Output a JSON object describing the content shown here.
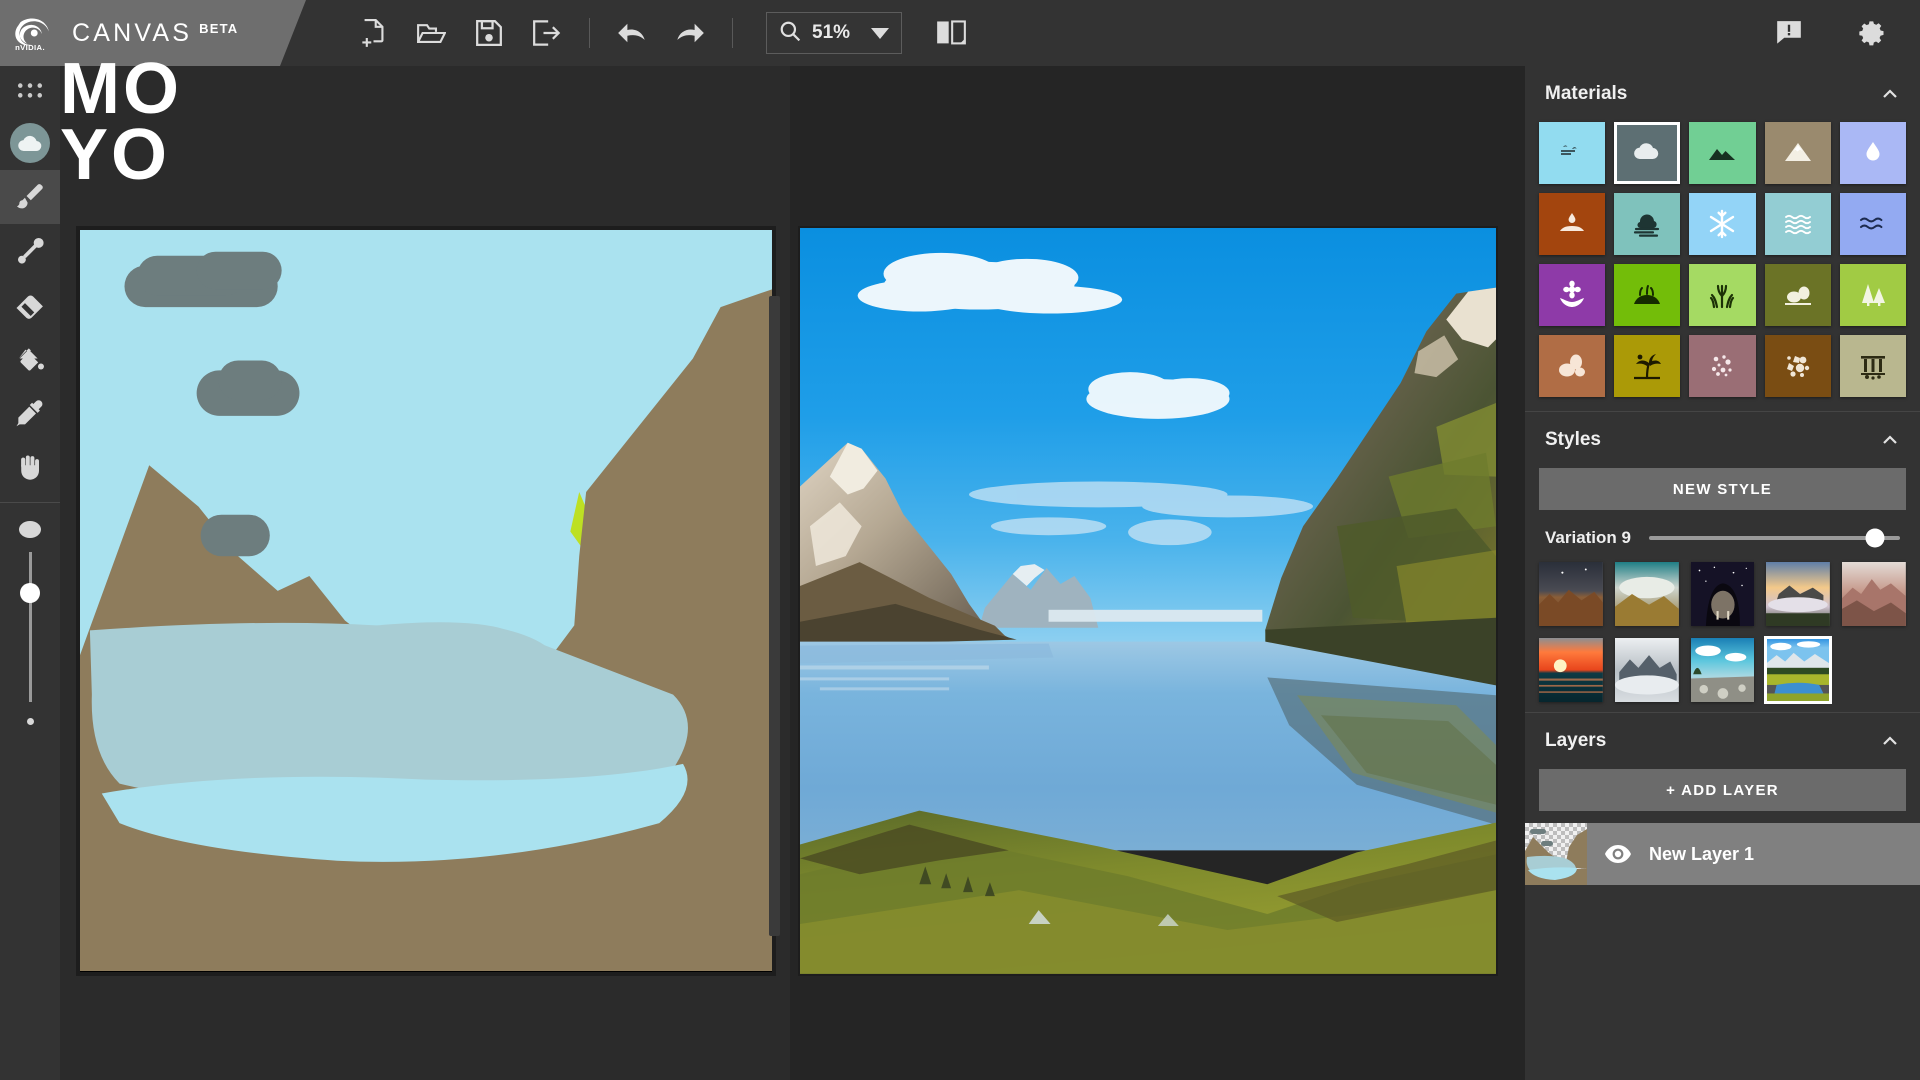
{
  "app": {
    "brand": "CANVAS",
    "beta": "BETA",
    "logo_icon": "nvidia-logo-icon"
  },
  "toolbar": {
    "items": [
      {
        "name": "new-file-button",
        "icon": "new-file-icon",
        "label": "New"
      },
      {
        "name": "open-file-button",
        "icon": "folder-open-icon",
        "label": "Open"
      },
      {
        "name": "save-button",
        "icon": "save-disk-icon",
        "label": "Save"
      },
      {
        "name": "export-button",
        "icon": "export-icon",
        "label": "Export"
      },
      {
        "name": "undo-button",
        "icon": "undo-arrow-icon",
        "label": "Undo"
      },
      {
        "name": "redo-button",
        "icon": "redo-arrow-icon",
        "label": "Redo"
      }
    ],
    "zoom": {
      "icon": "magnifier-icon",
      "value": "51%",
      "dropdown_icon": "caret-down-icon"
    },
    "compare_icon": "compare-panels-icon",
    "feedback_icon": "feedback-bubble-icon",
    "settings_icon": "gear-icon"
  },
  "left_rail": {
    "apps_icon": "grid-dots-icon",
    "current_material_icon": "cloud-icon",
    "tools": [
      {
        "name": "tool-paintbrush",
        "icon": "paintbrush-icon",
        "label": "Paint Brush",
        "selected": true
      },
      {
        "name": "tool-line",
        "icon": "line-tool-icon",
        "label": "Line",
        "selected": false
      },
      {
        "name": "tool-eraser",
        "icon": "eraser-icon",
        "label": "Eraser",
        "selected": false
      },
      {
        "name": "tool-fill",
        "icon": "paint-bucket-icon",
        "label": "Fill",
        "selected": false
      },
      {
        "name": "tool-eyedropper",
        "icon": "eyedropper-icon",
        "label": "Eyedropper",
        "selected": false
      },
      {
        "name": "tool-pan",
        "icon": "hand-icon",
        "label": "Pan",
        "selected": false
      }
    ],
    "brush_size": {
      "max_icon": "large-brush-dot-icon",
      "min_icon": "small-brush-dot-icon",
      "handle_position_pct": 27
    }
  },
  "watermark": {
    "line1": "MO",
    "line2": "YO"
  },
  "canvas": {
    "sketch_label": "segmentation-sketch",
    "render_label": "ai-rendered-output",
    "scrollbar": "vertical-scrollbar"
  },
  "panel": {
    "materials": {
      "title": "Materials",
      "collapse_icon": "chevron-up-icon",
      "swatches": [
        {
          "name": "material-sky",
          "label": "Sky",
          "color": "#92dcf0",
          "icon": "birds-sky-icon",
          "fg": "#1f2b2e",
          "selected": false
        },
        {
          "name": "material-clouds",
          "label": "Clouds",
          "color": "#5d6f73",
          "icon": "cloud-icon",
          "fg": "#e8edee",
          "selected": true
        },
        {
          "name": "material-hill",
          "label": "Hill",
          "color": "#71cf94",
          "icon": "hill-icon",
          "fg": "#173021",
          "selected": false
        },
        {
          "name": "material-mountain",
          "label": "Mountain",
          "color": "#9a8a6e",
          "icon": "mountain-icon",
          "fg": "#f3efe4",
          "selected": false
        },
        {
          "name": "material-water",
          "label": "Water",
          "color": "#aab8f5",
          "icon": "waterdrop-icon",
          "fg": "#ffffff",
          "selected": false
        },
        {
          "name": "material-mud",
          "label": "Mud",
          "color": "#a3450e",
          "icon": "mud-splash-icon",
          "fg": "#f7e9dd",
          "selected": false
        },
        {
          "name": "material-fog",
          "label": "Fog",
          "color": "#7fc2bc",
          "icon": "fog-icon",
          "fg": "#1e3533",
          "selected": false
        },
        {
          "name": "material-snow",
          "label": "Snow",
          "color": "#93d4f7",
          "icon": "snowflake-icon",
          "fg": "#ffffff",
          "selected": false
        },
        {
          "name": "material-sea",
          "label": "Sea",
          "color": "#93cdd3",
          "icon": "waves-white-icon",
          "fg": "#ffffff",
          "selected": false
        },
        {
          "name": "material-river",
          "label": "River",
          "color": "#93aaf2",
          "icon": "waves-dark-icon",
          "fg": "#1d2b4f",
          "selected": false
        },
        {
          "name": "material-flowers",
          "label": "Flowers",
          "color": "#8e3aa8",
          "icon": "flower-icon",
          "fg": "#ffffff",
          "selected": false
        },
        {
          "name": "material-grass",
          "label": "Grass",
          "color": "#73bd09",
          "icon": "grass-tuft-icon",
          "fg": "#152b00",
          "selected": false
        },
        {
          "name": "material-straw",
          "label": "Straw",
          "color": "#a5da63",
          "icon": "reeds-icon",
          "fg": "#1c3106",
          "selected": false
        },
        {
          "name": "material-bush",
          "label": "Bush",
          "color": "#6b7326",
          "icon": "bush-icon",
          "fg": "#f2f0df",
          "selected": false
        },
        {
          "name": "material-tree",
          "label": "Tree",
          "color": "#a1cb44",
          "icon": "pine-trees-icon",
          "fg": "#f2f5e4",
          "selected": false
        },
        {
          "name": "material-rock",
          "label": "Rock",
          "color": "#b06d45",
          "icon": "rocks-icon",
          "fg": "#f7e5d6",
          "selected": false
        },
        {
          "name": "material-sand",
          "label": "Sand",
          "color": "#ab9a07",
          "icon": "palm-beach-icon",
          "fg": "#1d1a00",
          "selected": false
        },
        {
          "name": "material-snow-dust",
          "label": "Snow Dust",
          "color": "#9a6e75",
          "icon": "snow-dust-icon",
          "fg": "#f6e8ea",
          "selected": false
        },
        {
          "name": "material-dirt",
          "label": "Dirt",
          "color": "#7a4d13",
          "icon": "dirt-clump-icon",
          "fg": "#f0e6d6",
          "selected": false
        },
        {
          "name": "material-ruins",
          "label": "Ruins",
          "color": "#b9b78f",
          "icon": "ruins-icon",
          "fg": "#2d2b14",
          "selected": false
        }
      ]
    },
    "styles": {
      "title": "Styles",
      "collapse_icon": "chevron-up-icon",
      "new_style_label": "NEW STYLE",
      "variation_label": "Variation 9",
      "variation_value": 9,
      "variation_max": 10,
      "thumbnails": [
        {
          "name": "style-thumb-1",
          "desc": "desert-buttes-night",
          "selected": false
        },
        {
          "name": "style-thumb-2",
          "desc": "cloudy-cliffs",
          "selected": false
        },
        {
          "name": "style-thumb-3",
          "desc": "starry-cave-arch",
          "selected": false
        },
        {
          "name": "style-thumb-4",
          "desc": "sunset-fog-valley",
          "selected": false
        },
        {
          "name": "style-thumb-5",
          "desc": "pink-rocky-ridge",
          "selected": false
        },
        {
          "name": "style-thumb-6",
          "desc": "orange-ocean-sunset",
          "selected": false
        },
        {
          "name": "style-thumb-7",
          "desc": "grey-misty-peaks",
          "selected": false
        },
        {
          "name": "style-thumb-8",
          "desc": "turquoise-shoreline",
          "selected": false
        },
        {
          "name": "style-thumb-9",
          "desc": "alpine-lake-meadow",
          "selected": true
        }
      ]
    },
    "layers": {
      "title": "Layers",
      "collapse_icon": "chevron-up-icon",
      "add_layer_label": "+ ADD LAYER",
      "items": [
        {
          "name": "layer-row-new-layer-1",
          "label": "New Layer 1",
          "visibility_icon": "eye-icon",
          "visible": true,
          "selected": true
        }
      ]
    }
  },
  "colors": {
    "topbar_bg": "#333333",
    "brand_bg": "#6e6e6e",
    "workspace_bg": "#2b2b2b",
    "panel_bg": "#333333",
    "button_grey": "#6b6b6b",
    "layer_selected": "#808080",
    "sketch_sky": "#aae2ef",
    "sketch_cloud": "#6d7d7e",
    "sketch_mountain": "#8e7c5c",
    "sketch_water": "#a8cdd4"
  }
}
